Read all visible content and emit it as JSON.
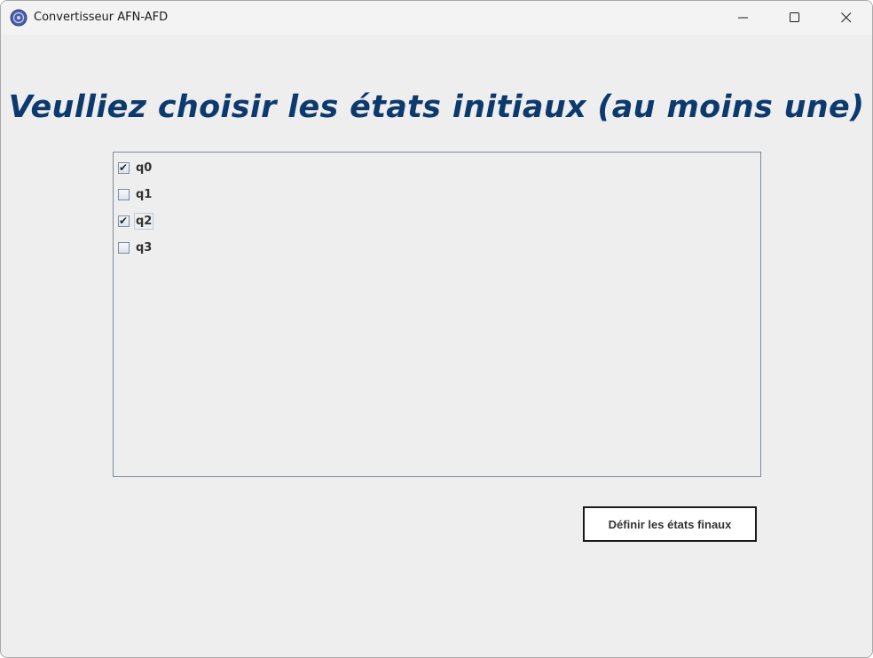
{
  "window": {
    "title": "Convertisseur AFN-AFD",
    "controls": {
      "minimize_icon": "minimize-icon",
      "maximize_icon": "maximize-icon",
      "close_icon": "close-icon"
    }
  },
  "main": {
    "heading": "Veulliez choisir les états initiaux (au moins une)",
    "states": [
      {
        "label": "q0",
        "checked": true
      },
      {
        "label": "q1",
        "checked": false
      },
      {
        "label": "q2",
        "checked": true
      },
      {
        "label": "q3",
        "checked": false
      }
    ],
    "next_button_label": "Définir les états finaux"
  },
  "colors": {
    "heading": "#0c3a6e",
    "background": "#eeeeee"
  }
}
